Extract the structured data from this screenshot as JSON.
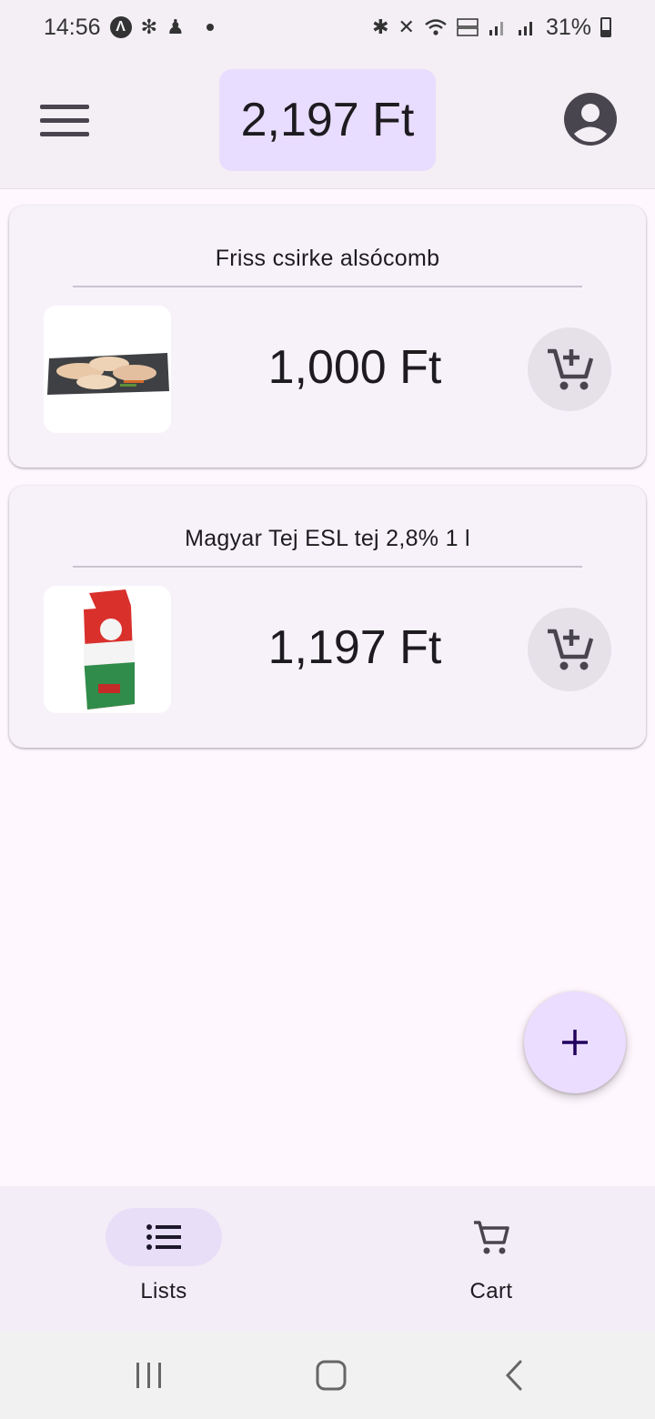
{
  "status_bar": {
    "time": "14:56",
    "battery": "31%",
    "left_icons": [
      "artificial-intelligence-icon",
      "fan-icon",
      "shield-person-icon",
      "dot-icon"
    ],
    "right_icons": [
      "bluetooth-icon",
      "mute-icon",
      "wifi-icon",
      "volte-icon",
      "signal-icon",
      "signal-icon",
      "battery-icon"
    ]
  },
  "app_bar": {
    "total": "2,197 Ft",
    "menu_icon": "menu-icon",
    "account_icon": "account-circle-icon"
  },
  "items": [
    {
      "name": "Friss csirke alsócomb",
      "price": "1,000 Ft",
      "image_icon": "chicken-drumsticks-image"
    },
    {
      "name": "Magyar Tej ESL tej 2,8% 1 l",
      "price": "1,197 Ft",
      "image_icon": "milk-carton-image"
    }
  ],
  "fab": {
    "icon": "plus-icon"
  },
  "bottom_nav": {
    "items": [
      {
        "label": "Lists",
        "icon": "list-icon",
        "active": true
      },
      {
        "label": "Cart",
        "icon": "cart-icon",
        "active": false
      }
    ]
  },
  "colors": {
    "accent": "#e9ddff",
    "surface": "#f3eff5",
    "background": "#fef7fe",
    "card": "#f7f2fa"
  }
}
